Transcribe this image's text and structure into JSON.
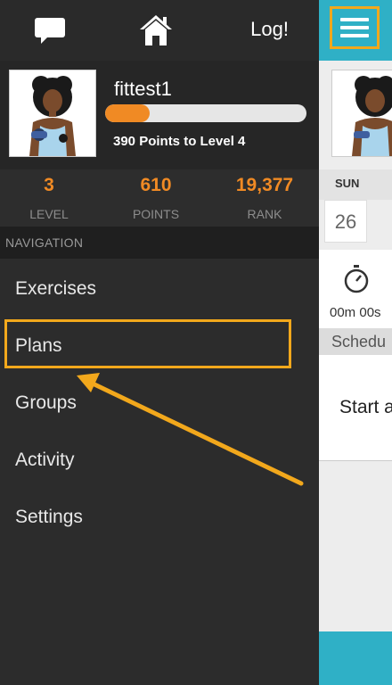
{
  "topbar": {
    "chat_icon": "chat-bubble-icon",
    "home_icon": "home-icon",
    "logout_label": "Log!"
  },
  "profile": {
    "username": "fittest1",
    "avatar": "woman-with-dumbbell-avatar",
    "level_progress": 0.22,
    "points_to_level": "390 Points to Level 4"
  },
  "stats": [
    {
      "value": "3",
      "label": "LEVEL"
    },
    {
      "value": "610",
      "label": "POINTS"
    },
    {
      "value": "19,377",
      "label": "RANK"
    }
  ],
  "navigation": {
    "header": "NAVIGATION",
    "items": [
      {
        "label": "Exercises"
      },
      {
        "label": "Plans"
      },
      {
        "label": "Groups"
      },
      {
        "label": "Activity"
      },
      {
        "label": "Settings"
      }
    ]
  },
  "main": {
    "menu_icon": "hamburger-menu-icon",
    "day_label": "SUN",
    "day_number": "26",
    "timer_icon": "stopwatch-icon",
    "timer": "00m 00s",
    "schedule": "Schedu",
    "start_text": "Start a"
  },
  "colors": {
    "accent": "#f08a24",
    "highlight": "#f2a81c",
    "header_teal": "#2fb0c6"
  }
}
